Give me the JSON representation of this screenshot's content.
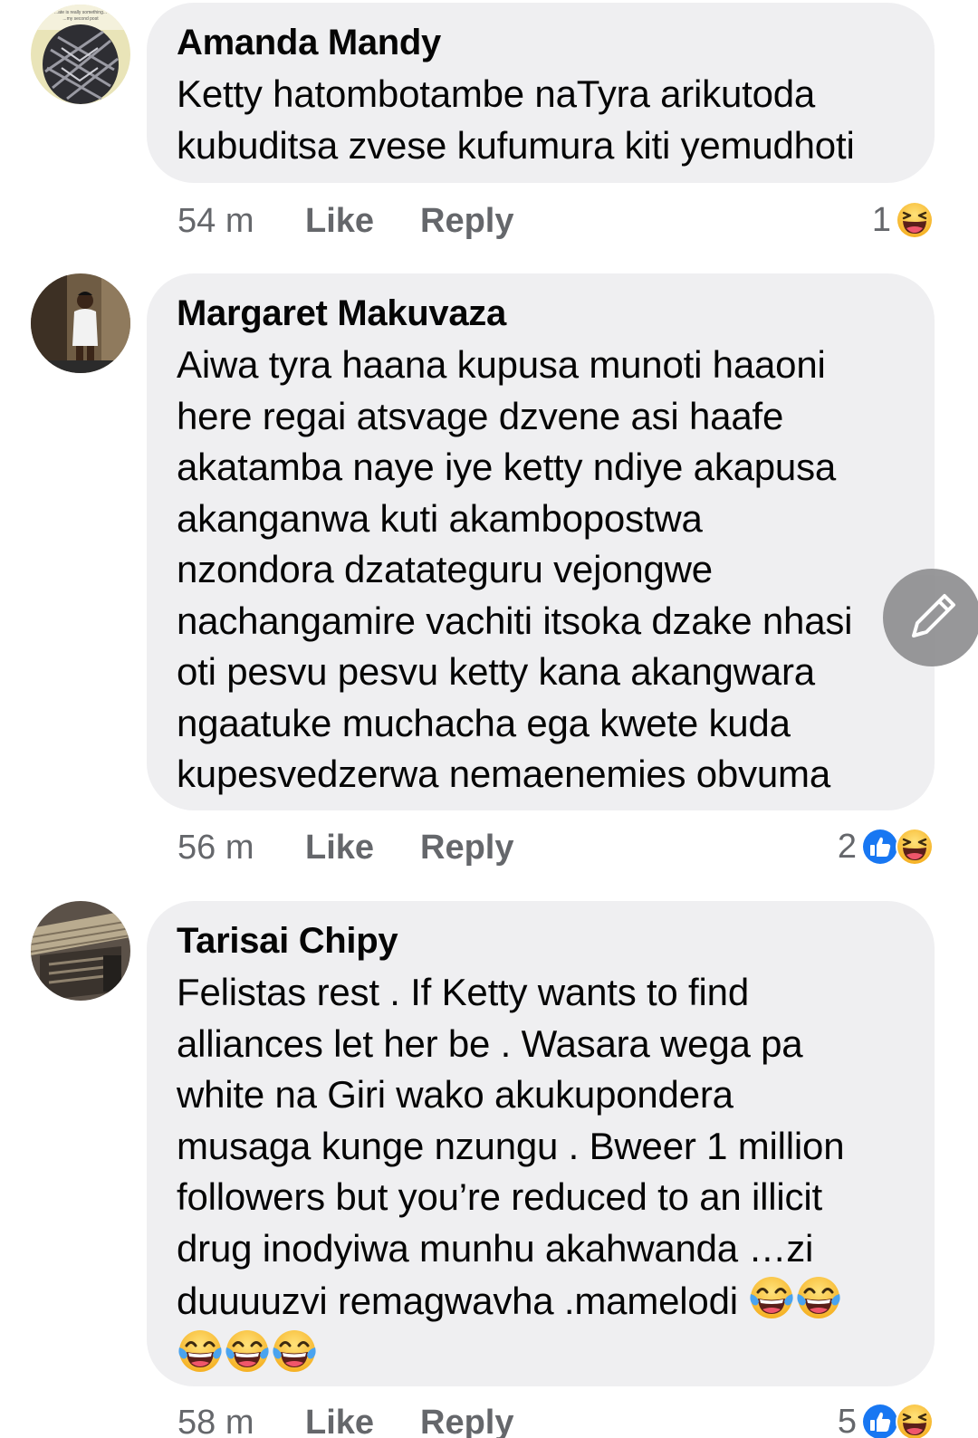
{
  "comments": [
    {
      "author": "Amanda Mandy",
      "text": "Ketty hatombotambe naTyra arikutoda\nkubuditsa zvese kufumura kiti yemudhoti",
      "time": "54 m",
      "like_label": "Like",
      "reply_label": "Reply",
      "reaction_count": "1",
      "reactions": [
        "haha-icon"
      ],
      "avatar_caption": [
        "...ate is really something...",
        "...my second post"
      ]
    },
    {
      "author": "Margaret Makuvaza",
      "text": "Aiwa tyra haana kupusa munoti haaoni\nhere regai atsvage dzvene asi haafe\nakatamba naye iye ketty ndiye akapusa\nakanganwa kuti akambopostwa\nnzondora dzatateguru vejongwe\nnachangamire vachiti itsoka dzake nhasi\noti pesvu pesvu ketty kana akangwara\nngaatuke muchacha ega kwete kuda\nkupesvedzerwa nemaenemies obvuma",
      "time": "56 m",
      "like_label": "Like",
      "reply_label": "Reply",
      "reaction_count": "2",
      "reactions": [
        "like-icon",
        "haha-icon"
      ]
    },
    {
      "author": "Tarisai Chipy",
      "text_line1": "Felistas rest . If Ketty wants to find",
      "text_line2": "alliances let her be . Wasara wega pa",
      "text_line3": "white na Giri wako akukupondera",
      "text_line4": "musaga kunge nzungu . Bweer 1 million",
      "text_line5": "followers but you’re reduced to an illicit",
      "text_line6": "drug inodyiwa munhu akahwanda …zi",
      "text_line7": "duuuuzvi remagwavha .mamelodi",
      "trailing_emojis": [
        "tears-of-joy",
        "tears-of-joy",
        "tears-of-joy",
        "tears-of-joy",
        "tears-of-joy"
      ],
      "time": "58 m",
      "like_label": "Like",
      "reply_label": "Reply",
      "reaction_count": "5",
      "reactions": [
        "like-icon",
        "haha-icon"
      ]
    }
  ],
  "colors": {
    "bubble": "#efeff1",
    "meta_text": "#65676b",
    "body_text": "#050505",
    "like_blue": "#1877f2",
    "emoji_yellow": "#fcc93d",
    "edit_button": "#8f8f91"
  },
  "edit_button_icon": "pencil-icon"
}
